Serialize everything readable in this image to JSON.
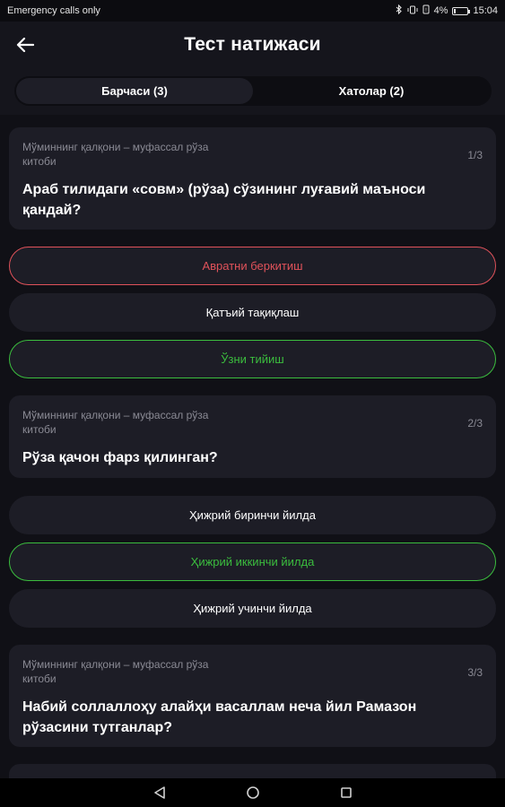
{
  "status_bar": {
    "carrier_text": "Emergency calls only",
    "icons": [
      "bluetooth-icon",
      "vibrate-icon",
      "data-icon",
      "battery-icon"
    ],
    "battery_text": "4%",
    "time": "15:04"
  },
  "header": {
    "title": "Тест натижаси",
    "back_icon": "arrow-left-icon"
  },
  "tabs": [
    {
      "label": "Барчаси (3)",
      "active": true
    },
    {
      "label": "Хатолар (2)",
      "active": false
    }
  ],
  "colors": {
    "background": "#15151c",
    "card": "#1d1d26",
    "wrong": "#e0525a",
    "correct": "#3bbd3e",
    "muted_text": "#8a8a94"
  },
  "questions": [
    {
      "source": "Мўминнинг қалқони – муфассал рўза китоби",
      "number": "1/3",
      "text": "Араб тилидаги «совм» (рўза) сўзининг луғавий маъноси қандай?",
      "answers": [
        {
          "label": "Авратни беркитиш",
          "state": "wrong"
        },
        {
          "label": "Қатъий тақиқлаш",
          "state": "neutral"
        },
        {
          "label": "Ўзни тийиш",
          "state": "correct"
        }
      ]
    },
    {
      "source": "Мўминнинг қалқони – муфассал рўза китоби",
      "number": "2/3",
      "text": "Рўза қачон фарз қилинган?",
      "answers": [
        {
          "label": "Ҳижрий биринчи йилда",
          "state": "neutral"
        },
        {
          "label": "Ҳижрий иккинчи йилда",
          "state": "correct"
        },
        {
          "label": "Ҳижрий учинчи йилда",
          "state": "neutral"
        }
      ]
    },
    {
      "source": "Мўминнинг қалқони – муфассал рўза китоби",
      "number": "3/3",
      "text": "Набий соллаллоҳу алайҳи васаллам неча йил Рамазон рўзасини тутганлар?",
      "answers": []
    }
  ],
  "nav_bar": {
    "icons": [
      "back-triangle-icon",
      "home-circle-icon",
      "recents-square-icon"
    ]
  }
}
